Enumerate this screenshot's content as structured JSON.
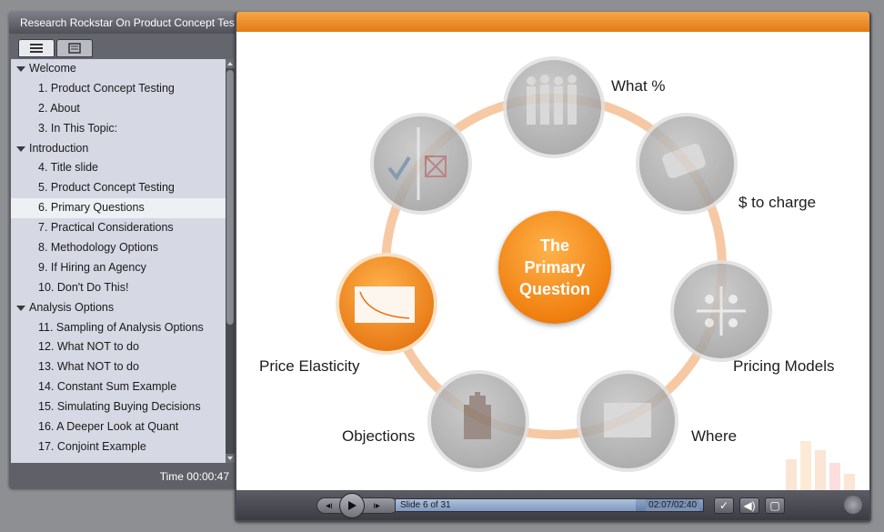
{
  "window": {
    "title": "Research Rockstar On Product Concept Testing"
  },
  "toc": {
    "rows": [
      {
        "type": "section",
        "label": "Welcome"
      },
      {
        "type": "item",
        "label": "1. Product Concept Testing"
      },
      {
        "type": "item",
        "label": "2. About"
      },
      {
        "type": "item",
        "label": "3. In This Topic:"
      },
      {
        "type": "section",
        "label": "Introduction"
      },
      {
        "type": "item",
        "label": "4. Title slide"
      },
      {
        "type": "item",
        "label": "5. Product Concept Testing"
      },
      {
        "type": "item",
        "label": "6. Primary Questions",
        "selected": true
      },
      {
        "type": "item",
        "label": "7. Practical Considerations"
      },
      {
        "type": "item",
        "label": "8. Methodology Options"
      },
      {
        "type": "item",
        "label": "9. If Hiring an Agency"
      },
      {
        "type": "item",
        "label": "10. Don't Do This!"
      },
      {
        "type": "section",
        "label": "Analysis Options"
      },
      {
        "type": "item",
        "label": "11. Sampling of Analysis Options"
      },
      {
        "type": "item",
        "label": "12. What NOT to do"
      },
      {
        "type": "item",
        "label": "13. What NOT to do"
      },
      {
        "type": "item",
        "label": "14. Constant Sum Example"
      },
      {
        "type": "item",
        "label": "15. Simulating Buying Decisions"
      },
      {
        "type": "item",
        "label": "16. A Deeper Look at Quant"
      },
      {
        "type": "item",
        "label": "17. Conjoint Example"
      }
    ],
    "time": "Time 00:00:47"
  },
  "slide": {
    "center_line1": "The",
    "center_line2": "Primary",
    "center_line3": "Question",
    "labels": {
      "what_pct": "What %",
      "to_charge": "$ to charge",
      "pricing_models": "Pricing Models",
      "where": "Where",
      "objections": "Objections",
      "price_elasticity": "Price Elasticity"
    },
    "colors": {
      "accent": "#f08a1c",
      "ring": "#f6c9a4"
    }
  },
  "player": {
    "slide_count": "Slide 6 of 31",
    "elapsed": "02:07/02:40",
    "progress": 0.78
  }
}
